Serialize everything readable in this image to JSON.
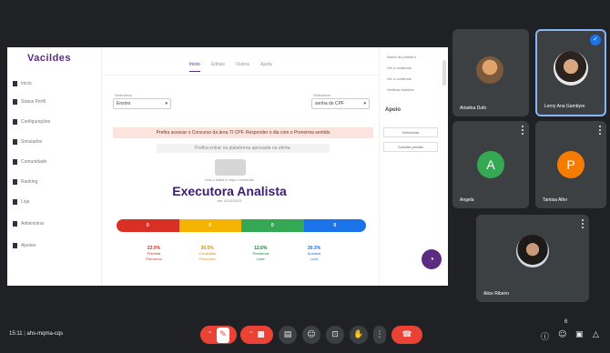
{
  "shared_screen": {
    "brand": "Vacildes",
    "sidebar": [
      {
        "label": "Inicio"
      },
      {
        "label": "Status Perfil"
      },
      {
        "label": "Configurações"
      },
      {
        "label": "Simulados"
      },
      {
        "label": "Comunidade"
      },
      {
        "label": "Ranking"
      },
      {
        "label": "Loja"
      },
      {
        "label": "Administrar"
      },
      {
        "label": "Ajustes"
      }
    ],
    "tabs": [
      "Início",
      "Editais",
      "Outros",
      "Ajuda"
    ],
    "select_left": {
      "label": "Selecionar",
      "value": "Ensino"
    },
    "select_right": {
      "label": "Selecionar",
      "value": "senha do CPF"
    },
    "alert_text": "Prefira acessar o Concurso da área TI CPF. Responder o dia com o Prenorma sentido",
    "info_text": "Prefira entrar na plataforma aprovada na oferta.",
    "exam_subtitle": "Leia o edital e veja o conteúdo",
    "exam_title": "Executora Analista",
    "exam_date": "em 10/10/2023",
    "bars": [
      "0",
      "0",
      "0",
      "0"
    ],
    "bar_colors": [
      "#d93025",
      "#f4b400",
      "#34a853",
      "#1a73e8"
    ],
    "stats": [
      {
        "pct": "22.0%",
        "line1": "Prevista",
        "line2": "Prenorma"
      },
      {
        "pct": "30.5%",
        "line1": "Conclusão",
        "line2": "Prenorma"
      },
      {
        "pct": "12.6%",
        "line1": "Prenorma",
        "line2": "Livre"
      },
      {
        "pct": "30.3%",
        "line1": "Analisar",
        "line2": "Livre"
      }
    ],
    "right_panel": {
      "items": [
        "Nome do primeiro",
        "Ver o conteúdo",
        "Ver o conteúdo",
        "Verificar estudos"
      ],
      "heading": "Apoio",
      "boxes": [
        "Selecionar",
        "Solicitar perdão"
      ]
    },
    "fab_icon": "chat-icon"
  },
  "participants": [
    {
      "name": "Ariadna Dufo",
      "type": "photo"
    },
    {
      "name": "Lerny Ana Gambyre",
      "type": "photo"
    },
    {
      "name": "Angela",
      "type": "letter",
      "letter": "A",
      "color": "#34a853"
    },
    {
      "name": "Tamisa Alfer",
      "type": "letter",
      "letter": "P",
      "color": "#f57c00"
    },
    {
      "name": "Alice Ribeiro",
      "type": "photo"
    }
  ],
  "meeting": {
    "time": "15:11",
    "code": "ahs-mqma-cqs"
  },
  "controls": [
    "mic-icon",
    "camera-icon",
    "captions-icon",
    "emoji-icon",
    "present-icon",
    "raise-hand-icon",
    "more-icon",
    "leave-call-icon"
  ],
  "right_controls": [
    "info-icon",
    "people-icon",
    "chat-icon",
    "activities-icon"
  ],
  "participants_count": "6"
}
